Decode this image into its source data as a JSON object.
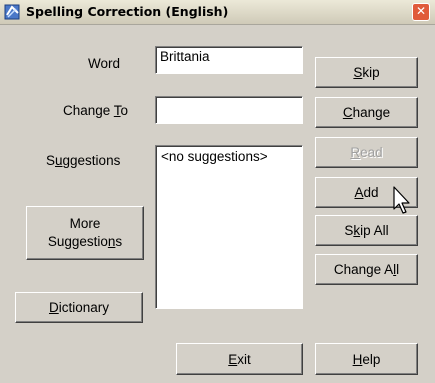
{
  "window": {
    "title": "Spelling Correction (English)",
    "close_glyph": "✕"
  },
  "labels": {
    "word": "Word",
    "change_to_pre": "Change ",
    "change_to_u": "T",
    "change_to_post": "o",
    "suggestions_pre": "S",
    "suggestions_u": "u",
    "suggestions_post": "ggestions"
  },
  "fields": {
    "word_value": "Brittania",
    "change_to_value": ""
  },
  "suggestions_list": {
    "items": [
      "<no suggestions>"
    ]
  },
  "buttons": {
    "skip": {
      "u": "S",
      "rest": "kip"
    },
    "change": {
      "u": "C",
      "rest": "hange"
    },
    "read": {
      "u": "R",
      "rest": "ead",
      "disabled": true
    },
    "add": {
      "u": "A",
      "rest": "dd"
    },
    "skip_all": {
      "pre": "S",
      "u": "k",
      "rest": "ip All"
    },
    "change_all": {
      "pre": "Change A",
      "u": "l",
      "rest": "l"
    },
    "more_suggestions": {
      "line1": "More",
      "line2_pre": "Suggestio",
      "line2_u": "n",
      "line2_post": "s"
    },
    "dictionary": {
      "u": "D",
      "rest": "ictionary"
    },
    "exit": {
      "u": "E",
      "rest": "xit"
    },
    "help": {
      "u": "H",
      "rest": "elp"
    }
  },
  "icons": {
    "app": "spelling-app-icon",
    "close": "close-icon",
    "cursor": "mouse-pointer-icon"
  }
}
